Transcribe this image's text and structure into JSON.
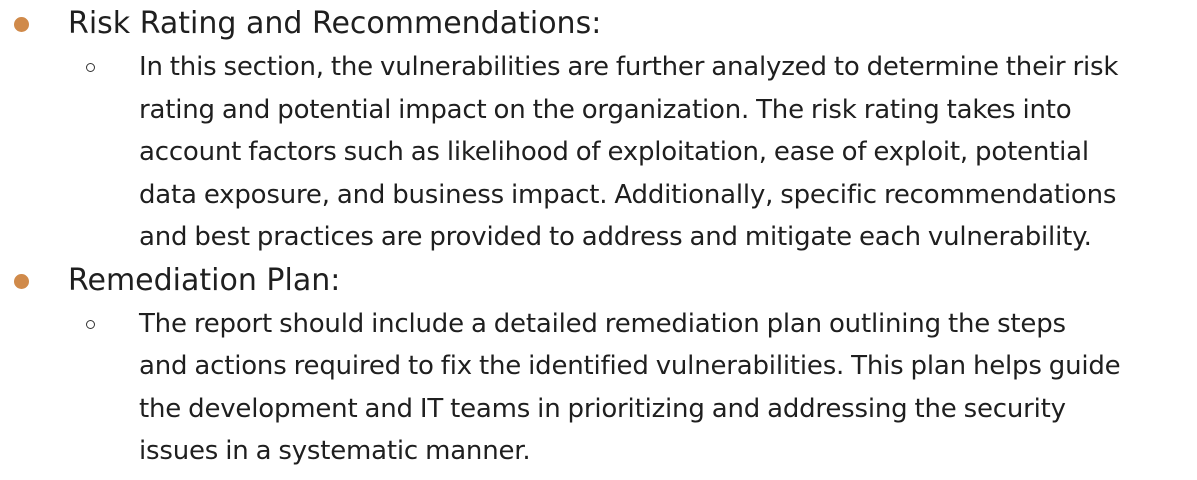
{
  "accent_color": "#d08a4a",
  "sections": [
    {
      "title": "Risk Rating and Recommendations:",
      "bullet_icon": "filled-circle",
      "sub_bullet_icon": "hollow-circle",
      "lines": [
        "In this section, the vulnerabilities are further analyzed to determine their risk",
        "rating and potential impact on the organization. The risk rating takes into",
        "account factors such as likelihood of exploitation, ease of exploit, potential",
        "data exposure, and business impact. Additionally, specific recommendations",
        "and best practices are provided to address and mitigate each vulnerability."
      ]
    },
    {
      "title": "Remediation Plan:",
      "bullet_icon": "filled-circle",
      "sub_bullet_icon": "hollow-circle",
      "lines": [
        "The report should include a detailed remediation plan outlining the steps",
        "and actions required to fix the identified vulnerabilities. This plan helps guide",
        "the development and IT teams in prioritizing and addressing the security",
        "issues in a systematic manner."
      ]
    }
  ]
}
